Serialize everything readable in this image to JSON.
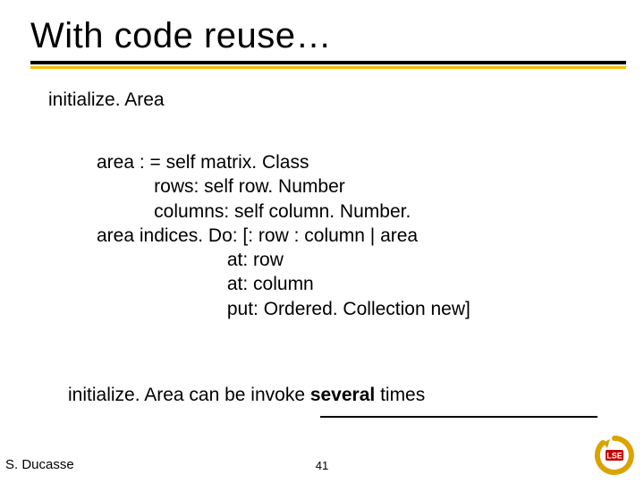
{
  "title": "With code reuse…",
  "method_name": "initialize. Area",
  "code_lines": {
    "l1": "area : = self matrix. Class",
    "l2": "           rows: self row. Number",
    "l3": "           columns: self column. Number.",
    "l4": "area indices. Do: [: row : column | area",
    "l5": "                         at: row",
    "l6": "                         at: column",
    "l7": "                         put: Ordered. Collection new]"
  },
  "note_prefix": "initialize. Area can be invoke ",
  "note_bold": "several",
  "note_suffix": " times",
  "footer": {
    "author": "S. Ducasse",
    "page": "41"
  },
  "logo_text": "LSE"
}
